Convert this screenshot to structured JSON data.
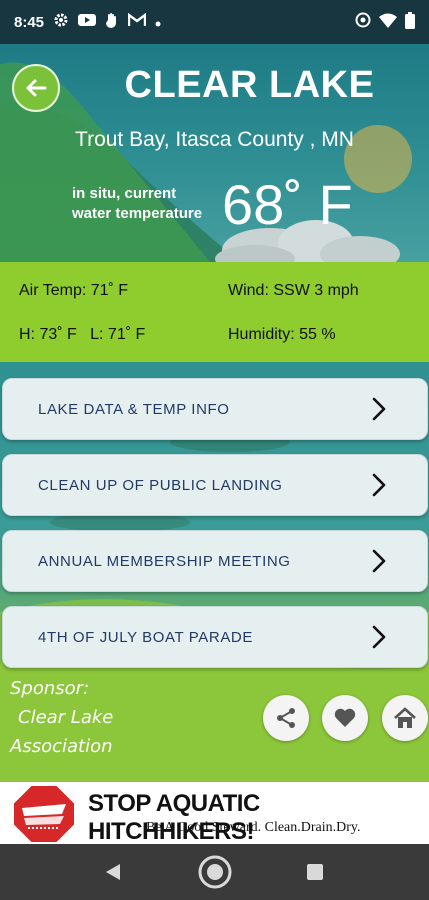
{
  "status": {
    "time": "8:45",
    "icons": [
      "settings-icon",
      "youtube-icon",
      "hand-icon",
      "gmail-icon",
      "dot-icon"
    ],
    "right_icons": [
      "eye-icon",
      "wifi-icon",
      "battery-icon"
    ]
  },
  "header": {
    "back_icon": "arrow-left-icon",
    "title": "CLEAR LAKE",
    "location": "Trout Bay, Itasca County , MN"
  },
  "water": {
    "label_line1": "in situ, current",
    "label_line2": "water temperature",
    "temperature": "68˚ F"
  },
  "weather": {
    "air_temp": "Air Temp: 71˚ F",
    "wind": "Wind: SSW 3  mph",
    "high_low": "H: 73˚ F   L: 71˚ F",
    "humidity": "Humidity: 55 %"
  },
  "menu": [
    {
      "label": "LAKE DATA & TEMP INFO"
    },
    {
      "label": "CLEAN UP OF PUBLIC LANDING"
    },
    {
      "label": "ANNUAL MEMBERSHIP MEETING"
    },
    {
      "label": "4TH OF JULY BOAT PARADE"
    }
  ],
  "sponsor": {
    "line1": "Sponsor:",
    "line2": "Clear Lake",
    "line3": "Association"
  },
  "actions": {
    "share_icon": "share-icon",
    "favorite_icon": "heart-icon",
    "home_icon": "home-icon"
  },
  "banner": {
    "title": "STOP AQUATIC HITCHHIKERS!",
    "subtitle": "Be A Good Steward. Clean.Drain.Dry."
  },
  "nav": {
    "icons": [
      "back-triangle-icon",
      "home-circle-icon",
      "recents-square-icon"
    ]
  },
  "colors": {
    "accent_green": "#8fcc2e",
    "button_text": "#223a66",
    "back_button": "#7cc13a"
  }
}
